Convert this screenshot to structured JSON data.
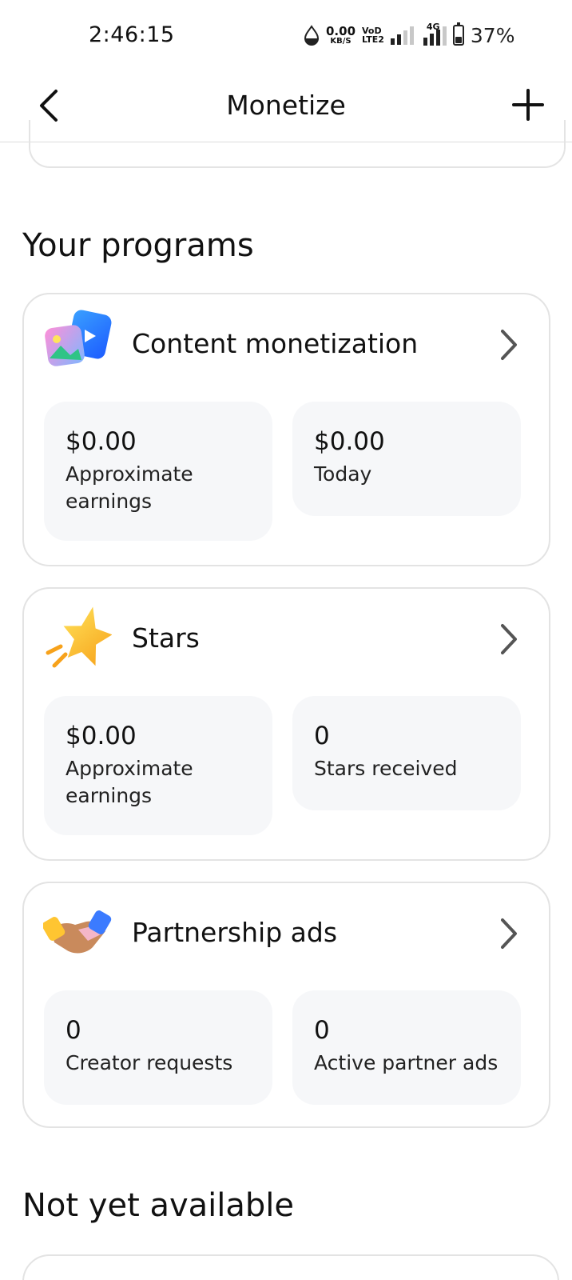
{
  "status_bar": {
    "time": "2:46:15",
    "net_speed_value": "0.00",
    "net_speed_unit": "KB/S",
    "volte_top": "VoD",
    "volte_bottom": "LTE2",
    "network_label": "4G",
    "battery_percent": "37%",
    "battery_level": 0.37
  },
  "header": {
    "title": "Monetize",
    "back_icon": "chevron-left-icon",
    "add_icon": "plus-icon"
  },
  "sections": {
    "programs_title": "Your programs",
    "not_available_title": "Not yet available"
  },
  "programs": [
    {
      "title": "Content monetization",
      "icon": "content-monetization-icon",
      "stats": [
        {
          "value": "$0.00",
          "label_line1": "Approximate",
          "label_line2": "earnings"
        },
        {
          "value": "$0.00",
          "label_line1": "Today",
          "label_line2": ""
        }
      ]
    },
    {
      "title": "Stars",
      "icon": "star-icon",
      "stats": [
        {
          "value": "$0.00",
          "label_line1": "Approximate",
          "label_line2": "earnings"
        },
        {
          "value": "0",
          "label_line1": "Stars received",
          "label_line2": ""
        }
      ]
    },
    {
      "title": "Partnership ads",
      "icon": "handshake-icon",
      "stats": [
        {
          "value": "0",
          "label_line1": "Creator requests",
          "label_line2": ""
        },
        {
          "value": "0",
          "label_line1": "Active partner ads",
          "label_line2": ""
        }
      ]
    }
  ],
  "colors": {
    "card_border": "#e3e3e3",
    "stat_bg": "#f6f7f9",
    "text": "#111111"
  }
}
